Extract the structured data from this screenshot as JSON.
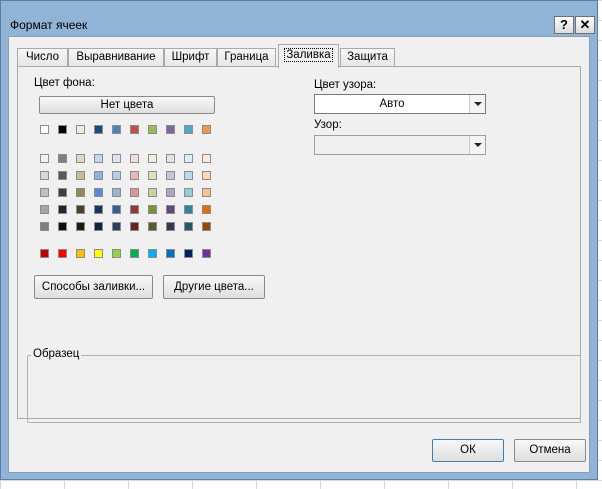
{
  "window": {
    "title": "Формат ячеек",
    "help_label": "?",
    "close_label": "✕"
  },
  "tabs": [
    {
      "label": "Число",
      "active": false
    },
    {
      "label": "Выравнивание",
      "active": false
    },
    {
      "label": "Шрифт",
      "active": false
    },
    {
      "label": "Граница",
      "active": false
    },
    {
      "label": "Заливка",
      "active": true
    },
    {
      "label": "Защита",
      "active": false
    }
  ],
  "background_color": {
    "label": "Цвет фона:",
    "no_color_label": "Нет цвета",
    "theme_top_row": [
      "#ffffff",
      "#000000",
      "#eeece1",
      "#1f497d",
      "#4f81bd",
      "#c0504d",
      "#9bbb59",
      "#8064a2",
      "#4bacc6",
      "#f79646"
    ],
    "theme_shades": [
      [
        "#f2f2f2",
        "#7f7f7f",
        "#ddd9c3",
        "#c6d9f0",
        "#dbe5f1",
        "#f2dcdb",
        "#ebf1dd",
        "#e5e0ec",
        "#dbeef3",
        "#fdeada"
      ],
      [
        "#d8d8d8",
        "#595959",
        "#c4bd97",
        "#8db3e2",
        "#b8cce4",
        "#e5b9b7",
        "#d7e3bc",
        "#ccc1d9",
        "#b7dde8",
        "#fbd5b5"
      ],
      [
        "#bfbfbf",
        "#3f3f3f",
        "#938953",
        "#548dd4",
        "#95b3d7",
        "#d99694",
        "#c3d69b",
        "#b2a2c7",
        "#92cddc",
        "#fac08f"
      ],
      [
        "#a5a5a5",
        "#262626",
        "#494429",
        "#17365d",
        "#366092",
        "#953734",
        "#76923c",
        "#5f497a",
        "#31859b",
        "#e36c09"
      ],
      [
        "#7f7f7f",
        "#0c0c0c",
        "#1d1b10",
        "#0f243e",
        "#244061",
        "#632423",
        "#4f6128",
        "#3f3151",
        "#205867",
        "#974806"
      ]
    ],
    "standard_colors": [
      "#c00000",
      "#ff0000",
      "#ffc000",
      "#ffff00",
      "#92d050",
      "#00b050",
      "#00b0f0",
      "#0070c0",
      "#002060",
      "#7030a0"
    ]
  },
  "buttons": {
    "fill_effects": "Способы заливки...",
    "more_colors": "Другие цвета...",
    "ok": "ОК",
    "cancel": "Отмена"
  },
  "pattern_color": {
    "label": "Цвет узора:",
    "value": "Авто"
  },
  "pattern_style": {
    "label": "Узор:",
    "value": ""
  },
  "sample": {
    "label": "Образец"
  }
}
